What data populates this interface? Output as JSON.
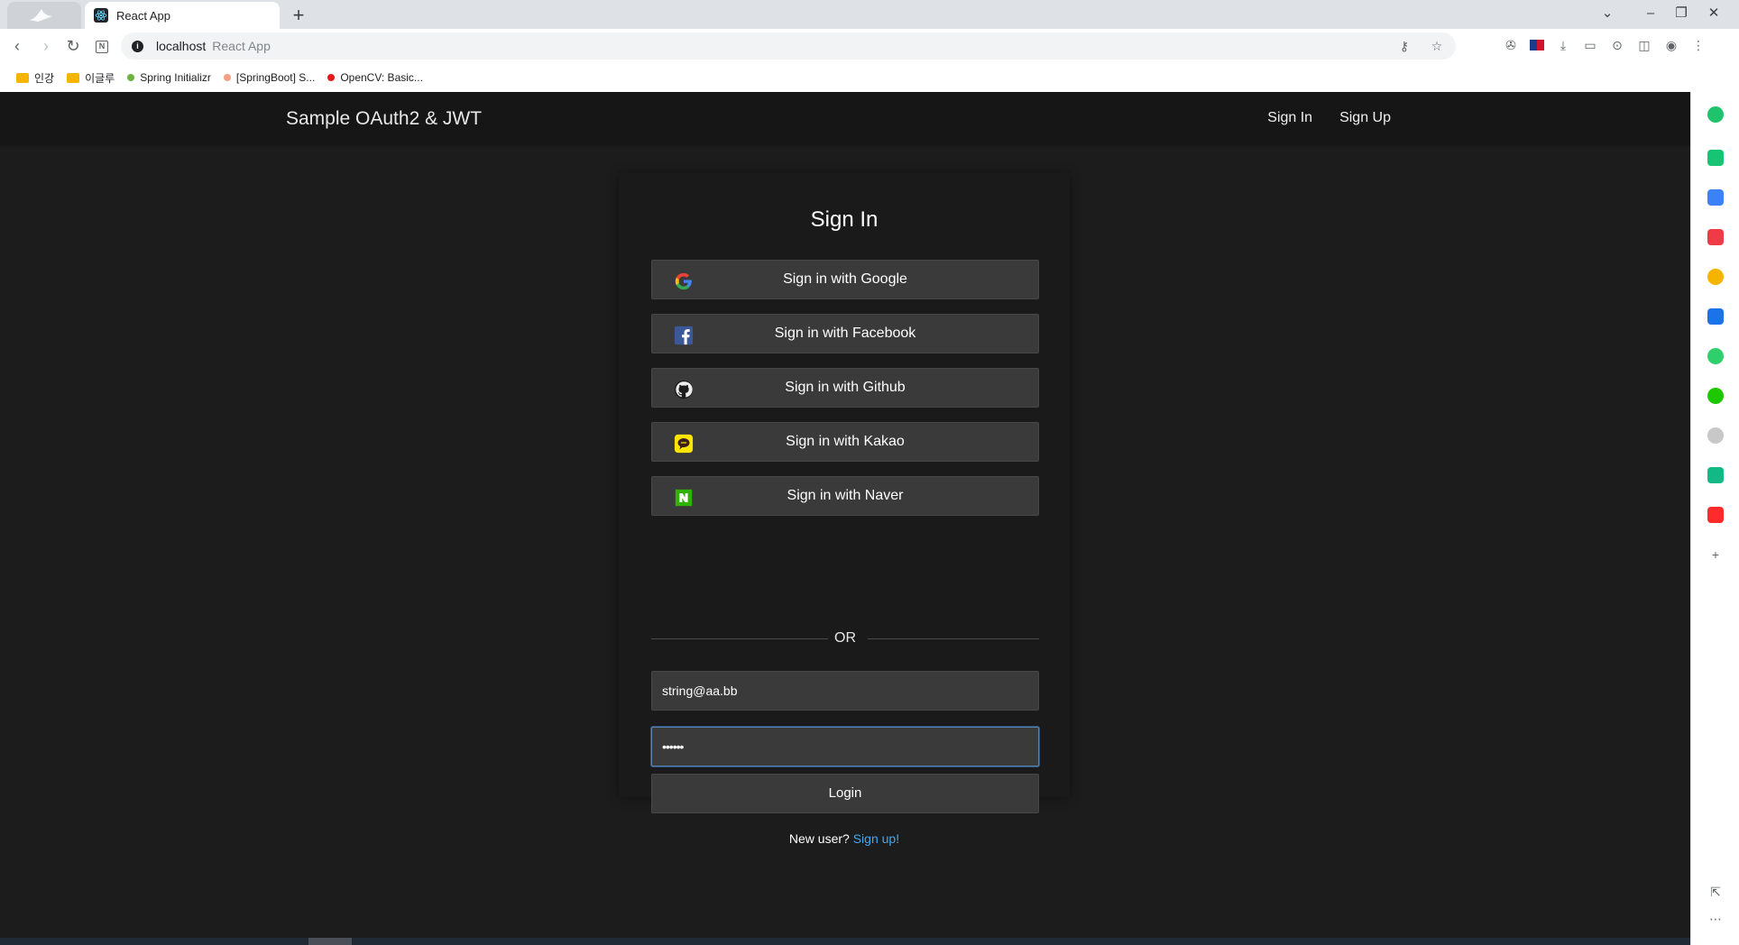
{
  "browser": {
    "tab_title": "React App",
    "url_host": "localhost",
    "url_page_title": "React App",
    "bookmarks": [
      {
        "label": "인강",
        "kind": "folder"
      },
      {
        "label": "이글루",
        "kind": "folder"
      },
      {
        "label": "Spring Initializr",
        "kind": "site",
        "color": "#6db33f"
      },
      {
        "label": "[SpringBoot] S...",
        "kind": "site",
        "color": "#f2a081"
      },
      {
        "label": "OpenCV: Basic...",
        "kind": "site",
        "color": "#e11a1a"
      }
    ]
  },
  "header": {
    "brand": "Sample OAuth2 & JWT",
    "nav": {
      "sign_in": "Sign In",
      "sign_up": "Sign Up"
    }
  },
  "login": {
    "title": "Sign In",
    "social": [
      {
        "label": "Sign in with Google",
        "icon": "google-icon"
      },
      {
        "label": "Sign in with Facebook",
        "icon": "facebook-icon"
      },
      {
        "label": "Sign in with Github",
        "icon": "github-icon"
      },
      {
        "label": "Sign in with Kakao",
        "icon": "kakao-icon"
      },
      {
        "label": "Sign in with Naver",
        "icon": "naver-icon"
      }
    ],
    "divider": "OR",
    "email_value": "string@aa.bb",
    "password_value": "••••••",
    "login_label": "Login",
    "new_user_text": "New user?",
    "signup_link": "Sign up!"
  },
  "colors": {
    "page_bg": "#1c1c1c",
    "header_bg": "#161616",
    "button_bg": "#3a3a3a",
    "link": "#3fa9f5"
  }
}
